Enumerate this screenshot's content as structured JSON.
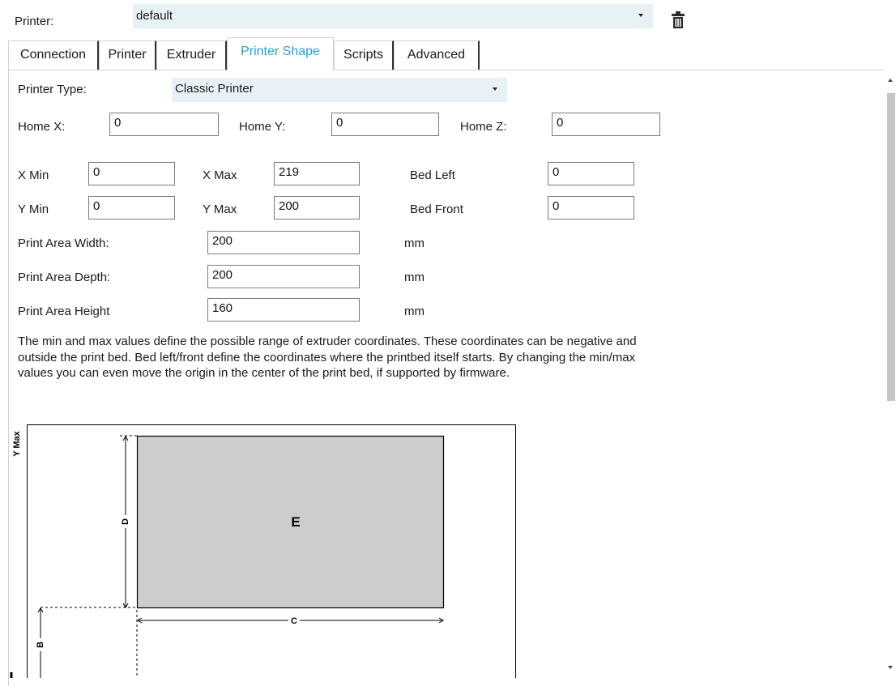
{
  "printer": {
    "label": "Printer:",
    "value": "default"
  },
  "tabs": [
    {
      "label": "Connection"
    },
    {
      "label": "Printer"
    },
    {
      "label": "Extruder"
    },
    {
      "label": "Printer Shape"
    },
    {
      "label": "Scripts"
    },
    {
      "label": "Advanced"
    }
  ],
  "shape": {
    "printer_type_label": "Printer Type:",
    "printer_type_value": "Classic Printer",
    "home_x_label": "Home X:",
    "home_x": "0",
    "home_y_label": "Home Y:",
    "home_y": "0",
    "home_z_label": "Home Z:",
    "home_z": "0",
    "x_min_label": "X Min",
    "x_min": "0",
    "x_max_label": "X Max",
    "x_max": "219",
    "bed_left_label": "Bed Left",
    "bed_left": "0",
    "y_min_label": "Y Min",
    "y_min": "0",
    "y_max_label": "Y Max",
    "y_max": "200",
    "bed_front_label": "Bed Front",
    "bed_front": "0",
    "width_label": "Print Area Width:",
    "width": "200",
    "depth_label": "Print Area Depth:",
    "depth": "200",
    "height_label": "Print Area Height",
    "height": "160",
    "unit": "mm",
    "info": "The min and max values define the possible range of extruder coordinates. These coordinates can be negative and outside the print bed. Bed left/front define the coordinates where the printbed itself starts. By changing the min/max values you can even move the origin in the center of the print bed, if supported by firmware."
  },
  "diagram": {
    "y_max_label": "Y Max",
    "label_d": "D",
    "label_e": "E",
    "label_c": "C",
    "label_b": "B"
  },
  "colors": {
    "accent": "#2a9fd8",
    "combo_bg": "#e8f1f5",
    "bed": "#cccccc"
  },
  "icons": {
    "delete": "trash-icon"
  }
}
